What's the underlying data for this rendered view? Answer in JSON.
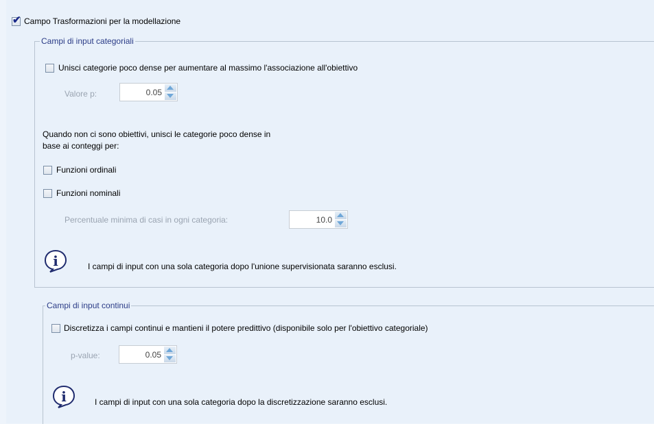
{
  "main_checkbox": {
    "label": "Campo Trasformazioni per la modellazione",
    "checked": true
  },
  "categorical_group": {
    "legend": "Campi di input categoriali",
    "merge_checkbox_label": "Unisci categorie poco dense per aumentare al massimo l'associazione all'obiettivo",
    "p_value_label": "Valore p:",
    "p_value": "0.05",
    "no_target_text_line1": "Quando non ci sono obiettivi, unisci le categorie poco dense in",
    "no_target_text_line2": "base ai conteggi per:",
    "ordinal_label": "Funzioni ordinali",
    "nominal_label": "Funzioni nominali",
    "min_pct_label": "Percentuale minima di casi in ogni categoria:",
    "min_pct_value": "10.0",
    "info_text": "I campi di input con una sola categoria dopo l'unione supervisionata saranno esclusi."
  },
  "continuous_group": {
    "legend": "Campi di input continui",
    "discretize_label": "Discretizza i campi continui e mantieni il potere predittivo (disponibile solo per l'obiettivo categoriale)",
    "p_value_label": "p-value:",
    "p_value": "0.05",
    "info_text": "I campi di input con una sola categoria dopo la discretizzazione saranno esclusi."
  },
  "icons": {
    "info": "info-balloon-icon",
    "checkmark": "checkmark-icon",
    "up": "spin-up-icon",
    "down": "spin-down-icon"
  }
}
